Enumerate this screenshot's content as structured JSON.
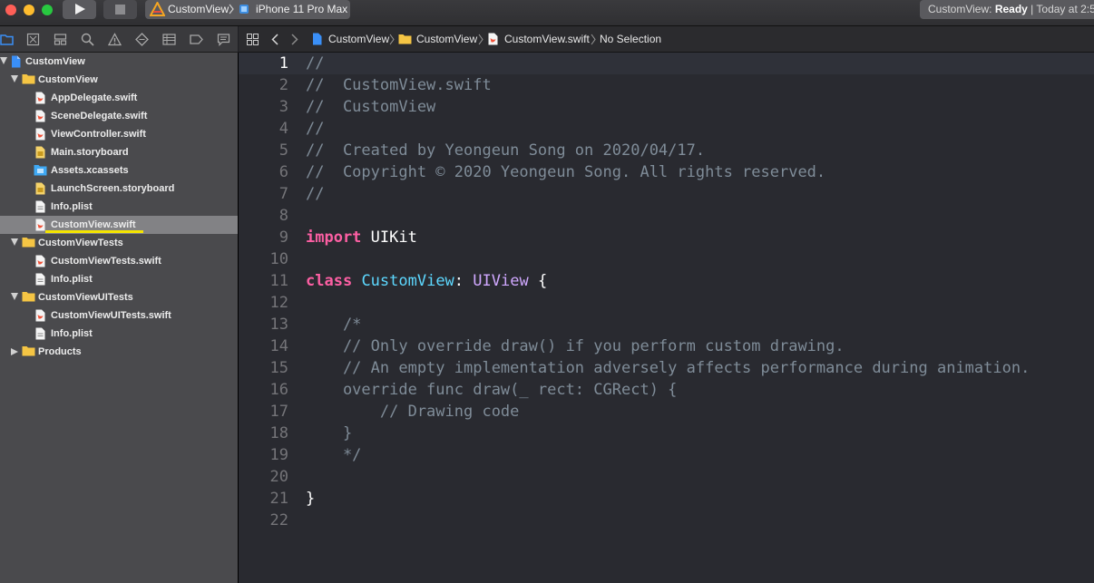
{
  "toolbar": {
    "scheme_name": "CustomView",
    "device_name": "iPhone 11 Pro Max",
    "status_prefix": "CustomView: ",
    "status_state": "Ready",
    "status_time": " | Today at 2:5"
  },
  "sidebar": {
    "items": [
      {
        "label": "CustomView",
        "kind": "project"
      },
      {
        "label": "CustomView",
        "kind": "folder"
      },
      {
        "label": "AppDelegate.swift",
        "kind": "swift"
      },
      {
        "label": "SceneDelegate.swift",
        "kind": "swift"
      },
      {
        "label": "ViewController.swift",
        "kind": "swift"
      },
      {
        "label": "Main.storyboard",
        "kind": "storyboard"
      },
      {
        "label": "Assets.xcassets",
        "kind": "assets"
      },
      {
        "label": "LaunchScreen.storyboard",
        "kind": "storyboard"
      },
      {
        "label": "Info.plist",
        "kind": "plist"
      },
      {
        "label": "CustomView.swift",
        "kind": "swift"
      },
      {
        "label": "CustomViewTests",
        "kind": "folder"
      },
      {
        "label": "CustomViewTests.swift",
        "kind": "swift"
      },
      {
        "label": "Info.plist",
        "kind": "plist"
      },
      {
        "label": "CustomViewUITests",
        "kind": "folder"
      },
      {
        "label": "CustomViewUITests.swift",
        "kind": "swift"
      },
      {
        "label": "Info.plist",
        "kind": "plist"
      },
      {
        "label": "Products",
        "kind": "folder"
      }
    ]
  },
  "jumpbar": {
    "project": "CustomView",
    "group": "CustomView",
    "file": "CustomView.swift",
    "selection": "No Selection"
  },
  "editor": {
    "current_line": 1,
    "lines": [
      {
        "num": "1",
        "parts": [
          {
            "t": "//",
            "c": "cmt"
          }
        ]
      },
      {
        "num": "2",
        "parts": [
          {
            "t": "//  CustomView.swift",
            "c": "cmt"
          }
        ]
      },
      {
        "num": "3",
        "parts": [
          {
            "t": "//  CustomView",
            "c": "cmt"
          }
        ]
      },
      {
        "num": "4",
        "parts": [
          {
            "t": "//",
            "c": "cmt"
          }
        ]
      },
      {
        "num": "5",
        "parts": [
          {
            "t": "//  Created by Yeongeun Song on 2020/04/17.",
            "c": "cmt"
          }
        ]
      },
      {
        "num": "6",
        "parts": [
          {
            "t": "//  Copyright © 2020 Yeongeun Song. All rights reserved.",
            "c": "cmt"
          }
        ]
      },
      {
        "num": "7",
        "parts": [
          {
            "t": "//",
            "c": "cmt"
          }
        ]
      },
      {
        "num": "8",
        "parts": []
      },
      {
        "num": "9",
        "parts": [
          {
            "t": "import",
            "c": "kw"
          },
          {
            "t": " UIKit",
            "c": "plain"
          }
        ]
      },
      {
        "num": "10",
        "parts": []
      },
      {
        "num": "11",
        "parts": [
          {
            "t": "class",
            "c": "kw"
          },
          {
            "t": " ",
            "c": "plain"
          },
          {
            "t": "CustomView",
            "c": "tdecl"
          },
          {
            "t": ": ",
            "c": "plain"
          },
          {
            "t": "UIView",
            "c": "tref"
          },
          {
            "t": " {",
            "c": "plain"
          }
        ]
      },
      {
        "num": "12",
        "parts": []
      },
      {
        "num": "13",
        "parts": [
          {
            "t": "    /*",
            "c": "cmt"
          }
        ]
      },
      {
        "num": "14",
        "parts": [
          {
            "t": "    // Only override draw() if you perform custom drawing.",
            "c": "cmt"
          }
        ]
      },
      {
        "num": "15",
        "parts": [
          {
            "t": "    // An empty implementation adversely affects performance during animation.",
            "c": "cmt"
          }
        ]
      },
      {
        "num": "16",
        "parts": [
          {
            "t": "    override func draw(_ rect: CGRect) {",
            "c": "cmt"
          }
        ]
      },
      {
        "num": "17",
        "parts": [
          {
            "t": "        // Drawing code",
            "c": "cmt"
          }
        ]
      },
      {
        "num": "18",
        "parts": [
          {
            "t": "    }",
            "c": "cmt"
          }
        ]
      },
      {
        "num": "19",
        "parts": [
          {
            "t": "    */",
            "c": "cmt"
          }
        ]
      },
      {
        "num": "20",
        "parts": []
      },
      {
        "num": "21",
        "parts": [
          {
            "t": "}",
            "c": "plain"
          }
        ]
      },
      {
        "num": "22",
        "parts": []
      }
    ]
  }
}
